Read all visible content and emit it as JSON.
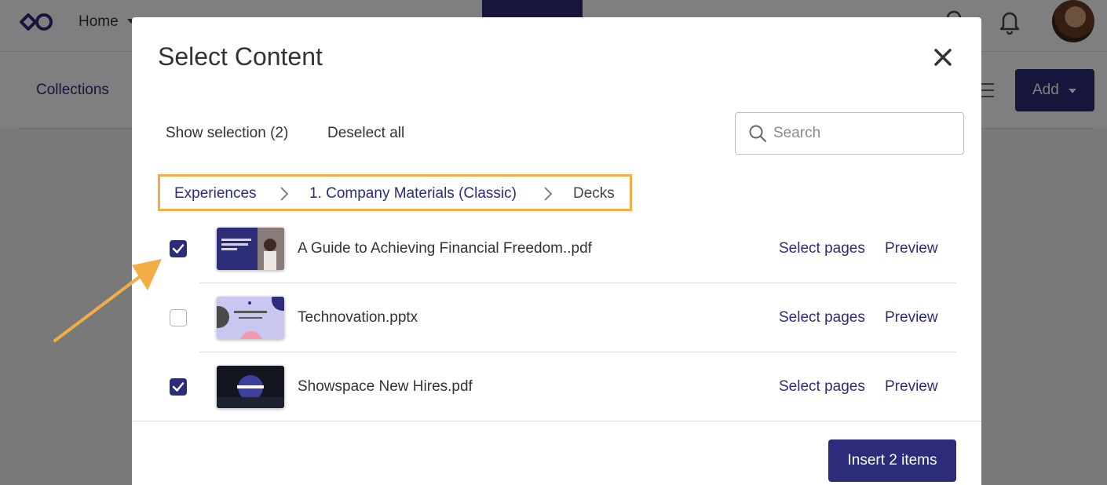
{
  "nav": {
    "home_label": "Home",
    "create_label": "",
    "icons": [
      "logo-icon",
      "search-icon",
      "bell-icon",
      "avatar"
    ]
  },
  "subbar": {
    "collections_label": "Collections",
    "add_label": "Add"
  },
  "modal": {
    "title": "Select Content",
    "show_selection_label": "Show selection (2)",
    "deselect_all_label": "Deselect all",
    "search_placeholder": "Search",
    "search_value": "",
    "breadcrumb": [
      {
        "label": "Experiences",
        "kind": "link"
      },
      {
        "label": "1. Company Materials (Classic)",
        "kind": "link"
      },
      {
        "label": "Decks",
        "kind": "current"
      }
    ],
    "items": [
      {
        "name": "A Guide to Achieving Financial Freedom..pdf",
        "checked": true,
        "thumb_text": "The Art of Selling Managing your finances",
        "select_pages_label": "Select pages",
        "preview_label": "Preview"
      },
      {
        "name": "Technovation.pptx",
        "checked": false,
        "thumb_text": "Technovation",
        "select_pages_label": "Select pages",
        "preview_label": "Preview"
      },
      {
        "name": "Showspace New Hires.pdf",
        "checked": true,
        "thumb_text": "Showspace",
        "select_pages_label": "Select pages",
        "preview_label": "Preview"
      }
    ],
    "insert_label": "Insert 2 items"
  },
  "colors": {
    "primary": "#2c2c7a",
    "highlight": "#f4ac45",
    "overlay": "rgba(0,0,0,0.5)"
  }
}
